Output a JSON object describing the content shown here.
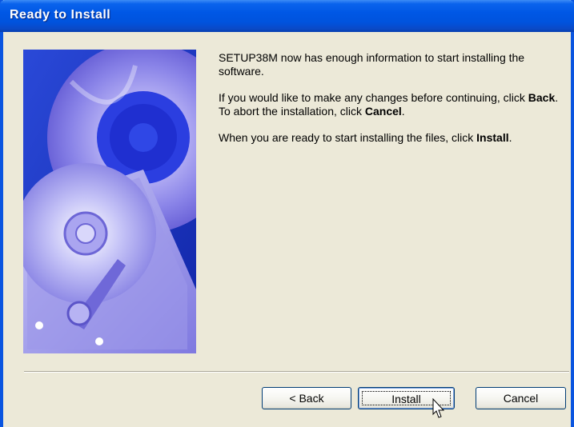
{
  "window": {
    "title": "Ready to Install"
  },
  "content": {
    "line1": "SETUP38M now has enough information to start installing the software.",
    "line2_pre": "If you would like to make any changes before continuing, click ",
    "line2_back": "Back",
    "line2_mid": ". To abort the installation, click ",
    "line2_cancel": "Cancel",
    "line2_post": ".",
    "line3_pre": "When you are ready to start installing the files, click ",
    "line3_install": "Install",
    "line3_post": "."
  },
  "buttons": {
    "back_label": "< Back",
    "install_label": "Install",
    "cancel_label": "Cancel"
  },
  "colors": {
    "titlebar": "#0054e3",
    "dialog_bg": "#ece9d8",
    "art_bg": "#1b37c8"
  },
  "icons": {
    "cursor": "mouse-pointer-icon",
    "art": "cd-and-harddisk-illustration"
  }
}
